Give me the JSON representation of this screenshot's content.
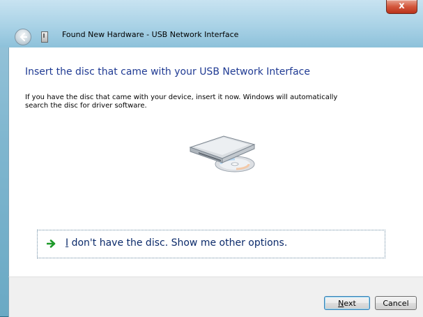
{
  "window": {
    "title": "Found New Hardware - USB Network Interface",
    "close_glyph": "x"
  },
  "main": {
    "heading": "Insert the disc that came with your USB Network Interface",
    "description": "If you have the disc that came with your device, insert it now.  Windows will automatically search the disc for driver software.",
    "option": {
      "mnemonic": "I",
      "rest": " don't have the disc.  Show me other options."
    }
  },
  "footer": {
    "next_mnemonic": "N",
    "next_rest": "ext",
    "cancel_label": "Cancel"
  },
  "icons": {
    "back": "back-arrow-icon",
    "hardware": "hardware-device-icon",
    "drive": "optical-drive-icon",
    "option_arrow": "green-arrow-icon"
  }
}
